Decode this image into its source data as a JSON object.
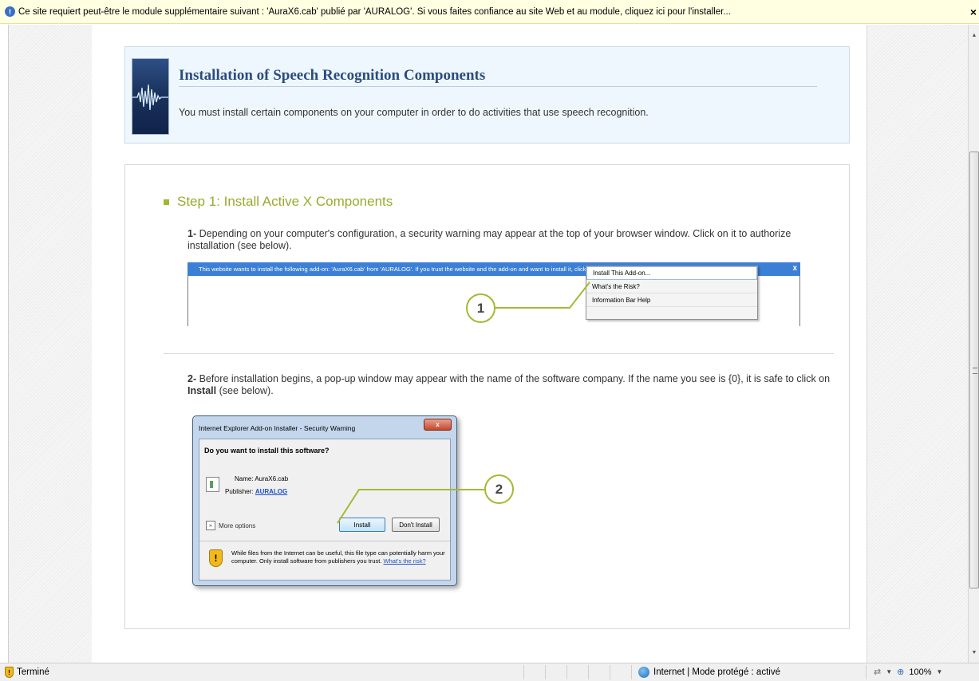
{
  "infobar": {
    "icon": "info-shield-icon",
    "text": "Ce site requiert peut-être le module supplémentaire suivant : 'AuraX6.cab' publié par 'AURALOG'. Si vous faites confiance au site Web et au module, cliquez ici pour l'installer...",
    "close": "×"
  },
  "header": {
    "title": "Installation of Speech Recognition Components",
    "subtitle": "You must install certain components on your computer in order to do activities that use speech recognition."
  },
  "step1": {
    "title": "Step 1: Install Active X Components",
    "instr1_num": "1-",
    "instr1_text": " Depending on your computer's configuration, a security warning may appear at the top of your browser window. Click on it to authorize installation (see below).",
    "instr2_num": "2-",
    "instr2_text_a": " Before installation begins, a pop-up window may appear with the name of the software company. If the name you see is {0}, it is safe to click on ",
    "instr2_bold": "Install",
    "instr2_text_b": " (see below)."
  },
  "shot1": {
    "bar_text": "This website wants to install the following add-on: 'AuraX6.cab' from 'AURALOG'. If you trust the website and the add-on and want to install it, click here...",
    "bar_close": "x",
    "menu": [
      "Install This Add-on...",
      "What's the Risk?",
      "Information Bar Help"
    ],
    "callout": "1"
  },
  "shot2": {
    "title": "Internet Explorer Add-on Installer - Security Warning",
    "close": "x",
    "question": "Do you want to install this software?",
    "name_label": "Name:",
    "name_value": "AuraX6.cab",
    "publisher_label": "Publisher:",
    "publisher_value": "AURALOG",
    "more_options": "More options",
    "install": "Install",
    "dont_install": "Don't Install",
    "warning": "While files from the Internet can be useful, this file type can potentially harm your computer. Only install software from publishers you trust.",
    "risk_link": "What's the risk?",
    "callout": "2"
  },
  "status": {
    "done": "Terminé",
    "zone": "Internet | Mode protégé : activé",
    "zoom": "100%"
  },
  "colors": {
    "accent_green": "#a6b62f",
    "header_blue": "#2a4c7d",
    "infobar_bg": "#ffffe1"
  }
}
